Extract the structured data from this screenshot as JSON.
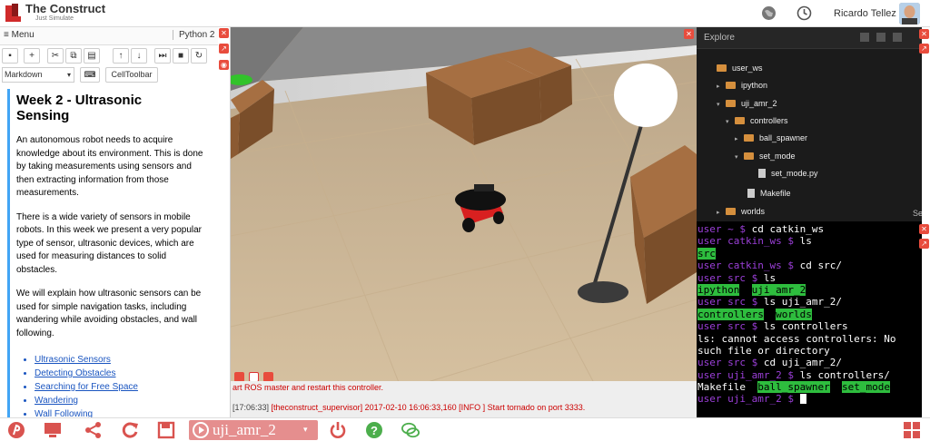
{
  "app": {
    "brand": "The Construct",
    "tagline": "Just Simulate",
    "user_name": "Ricardo Tellez"
  },
  "notebook": {
    "menu_label": "≡ Menu",
    "kernel": "Python 2",
    "cell_type": "Markdown",
    "celltoolbar_label": "CellToolbar",
    "title": "Week 2 - Ultrasonic Sensing",
    "paragraphs": [
      "An autonomous robot needs to acquire knowledge about its environment. This is done by taking measurements using sensors and then extracting information from those measurements.",
      "There is a wide variety of sensors in mobile robots. In this week we present a very popular type of sensor, ultrasonic devices, which are used for measuring distances to solid obstacles.",
      "We will explain how ultrasonic sensors can be used for simple navigation tasks, including wandering while avoiding obstacles, and wall following."
    ],
    "links": [
      "Ultrasonic Sensors",
      "Detecting Obstacles",
      "Searching for Free Space",
      "Wandering",
      "Wall Following"
    ]
  },
  "simulation": {
    "log_line1": "art ROS master and restart this controller.",
    "log_time": "[17:06:33]",
    "log_line2": " [theconstruct_supervisor] 2017-02-10 16:06:33,160 [INFO ] Start tornado on port 3333."
  },
  "explorer": {
    "title": "Explore",
    "items": [
      {
        "label": "user_ws",
        "type": "folder",
        "arrow": ""
      },
      {
        "label": "ipython",
        "type": "folder",
        "arrow": "▸"
      },
      {
        "label": "uji_amr_2",
        "type": "folder",
        "arrow": "▾"
      },
      {
        "label": "controllers",
        "type": "folder",
        "arrow": "▾"
      },
      {
        "label": "ball_spawner",
        "type": "folder",
        "arrow": "▸"
      },
      {
        "label": "set_mode",
        "type": "folder",
        "arrow": "▾"
      },
      {
        "label": "set_mode.py",
        "type": "file",
        "arrow": ""
      },
      {
        "label": "Makefile",
        "type": "file",
        "arrow": ""
      },
      {
        "label": "worlds",
        "type": "folder",
        "arrow": "▸"
      }
    ],
    "edge_fragment": "Se"
  },
  "terminal": {
    "lines": [
      [
        {
          "t": "user ~ $ ",
          "c": "p-user"
        },
        {
          "t": "cd catkin_ws",
          "c": "p-cmd"
        }
      ],
      [
        {
          "t": "user catkin_ws $ ",
          "c": "p-user"
        },
        {
          "t": "ls",
          "c": "p-cmd"
        }
      ],
      [
        {
          "t": "src",
          "c": "p-dir"
        }
      ],
      [
        {
          "t": "user catkin_ws $ ",
          "c": "p-user"
        },
        {
          "t": "cd src/",
          "c": "p-cmd"
        }
      ],
      [
        {
          "t": "user src $ ",
          "c": "p-user"
        },
        {
          "t": "ls",
          "c": "p-cmd"
        }
      ],
      [
        {
          "t": "ipython",
          "c": "p-dir"
        },
        {
          "t": "  ",
          "c": "p-out"
        },
        {
          "t": "uji_amr_2",
          "c": "p-dir"
        }
      ],
      [
        {
          "t": "user src $ ",
          "c": "p-user"
        },
        {
          "t": "ls uji_amr_2/",
          "c": "p-cmd"
        }
      ],
      [
        {
          "t": "controllers",
          "c": "p-dir"
        },
        {
          "t": "  ",
          "c": "p-out"
        },
        {
          "t": "worlds",
          "c": "p-dir"
        }
      ],
      [
        {
          "t": "user src $ ",
          "c": "p-user"
        },
        {
          "t": "ls controllers",
          "c": "p-cmd"
        }
      ],
      [
        {
          "t": "ls: cannot access controllers: No",
          "c": "p-out"
        }
      ],
      [
        {
          "t": "such file or directory",
          "c": "p-out"
        }
      ],
      [
        {
          "t": "user src $ ",
          "c": "p-user"
        },
        {
          "t": "cd uji_amr_2/",
          "c": "p-cmd"
        }
      ],
      [
        {
          "t": "user uji_amr_2 $ ",
          "c": "p-user"
        },
        {
          "t": "ls controllers/",
          "c": "p-cmd"
        }
      ],
      [
        {
          "t": "Makefile",
          "c": "p-out"
        },
        {
          "t": "  ",
          "c": "p-out"
        },
        {
          "t": "ball_spawner",
          "c": "p-dir"
        },
        {
          "t": "  ",
          "c": "p-out"
        },
        {
          "t": "set_mode",
          "c": "p-dir"
        }
      ],
      [
        {
          "t": "user uji_amr_2 $ ",
          "c": "p-user"
        }
      ]
    ]
  },
  "bottombar": {
    "simulation_name": "uji_amr_2",
    "accent": "#d9534f"
  },
  "colors": {
    "accent_red": "#d9534f",
    "link_blue": "#1a55c0",
    "notebook_border": "#42a5f5",
    "prompt_purple": "#9b3fd8",
    "dir_green": "#2ebd3e"
  }
}
